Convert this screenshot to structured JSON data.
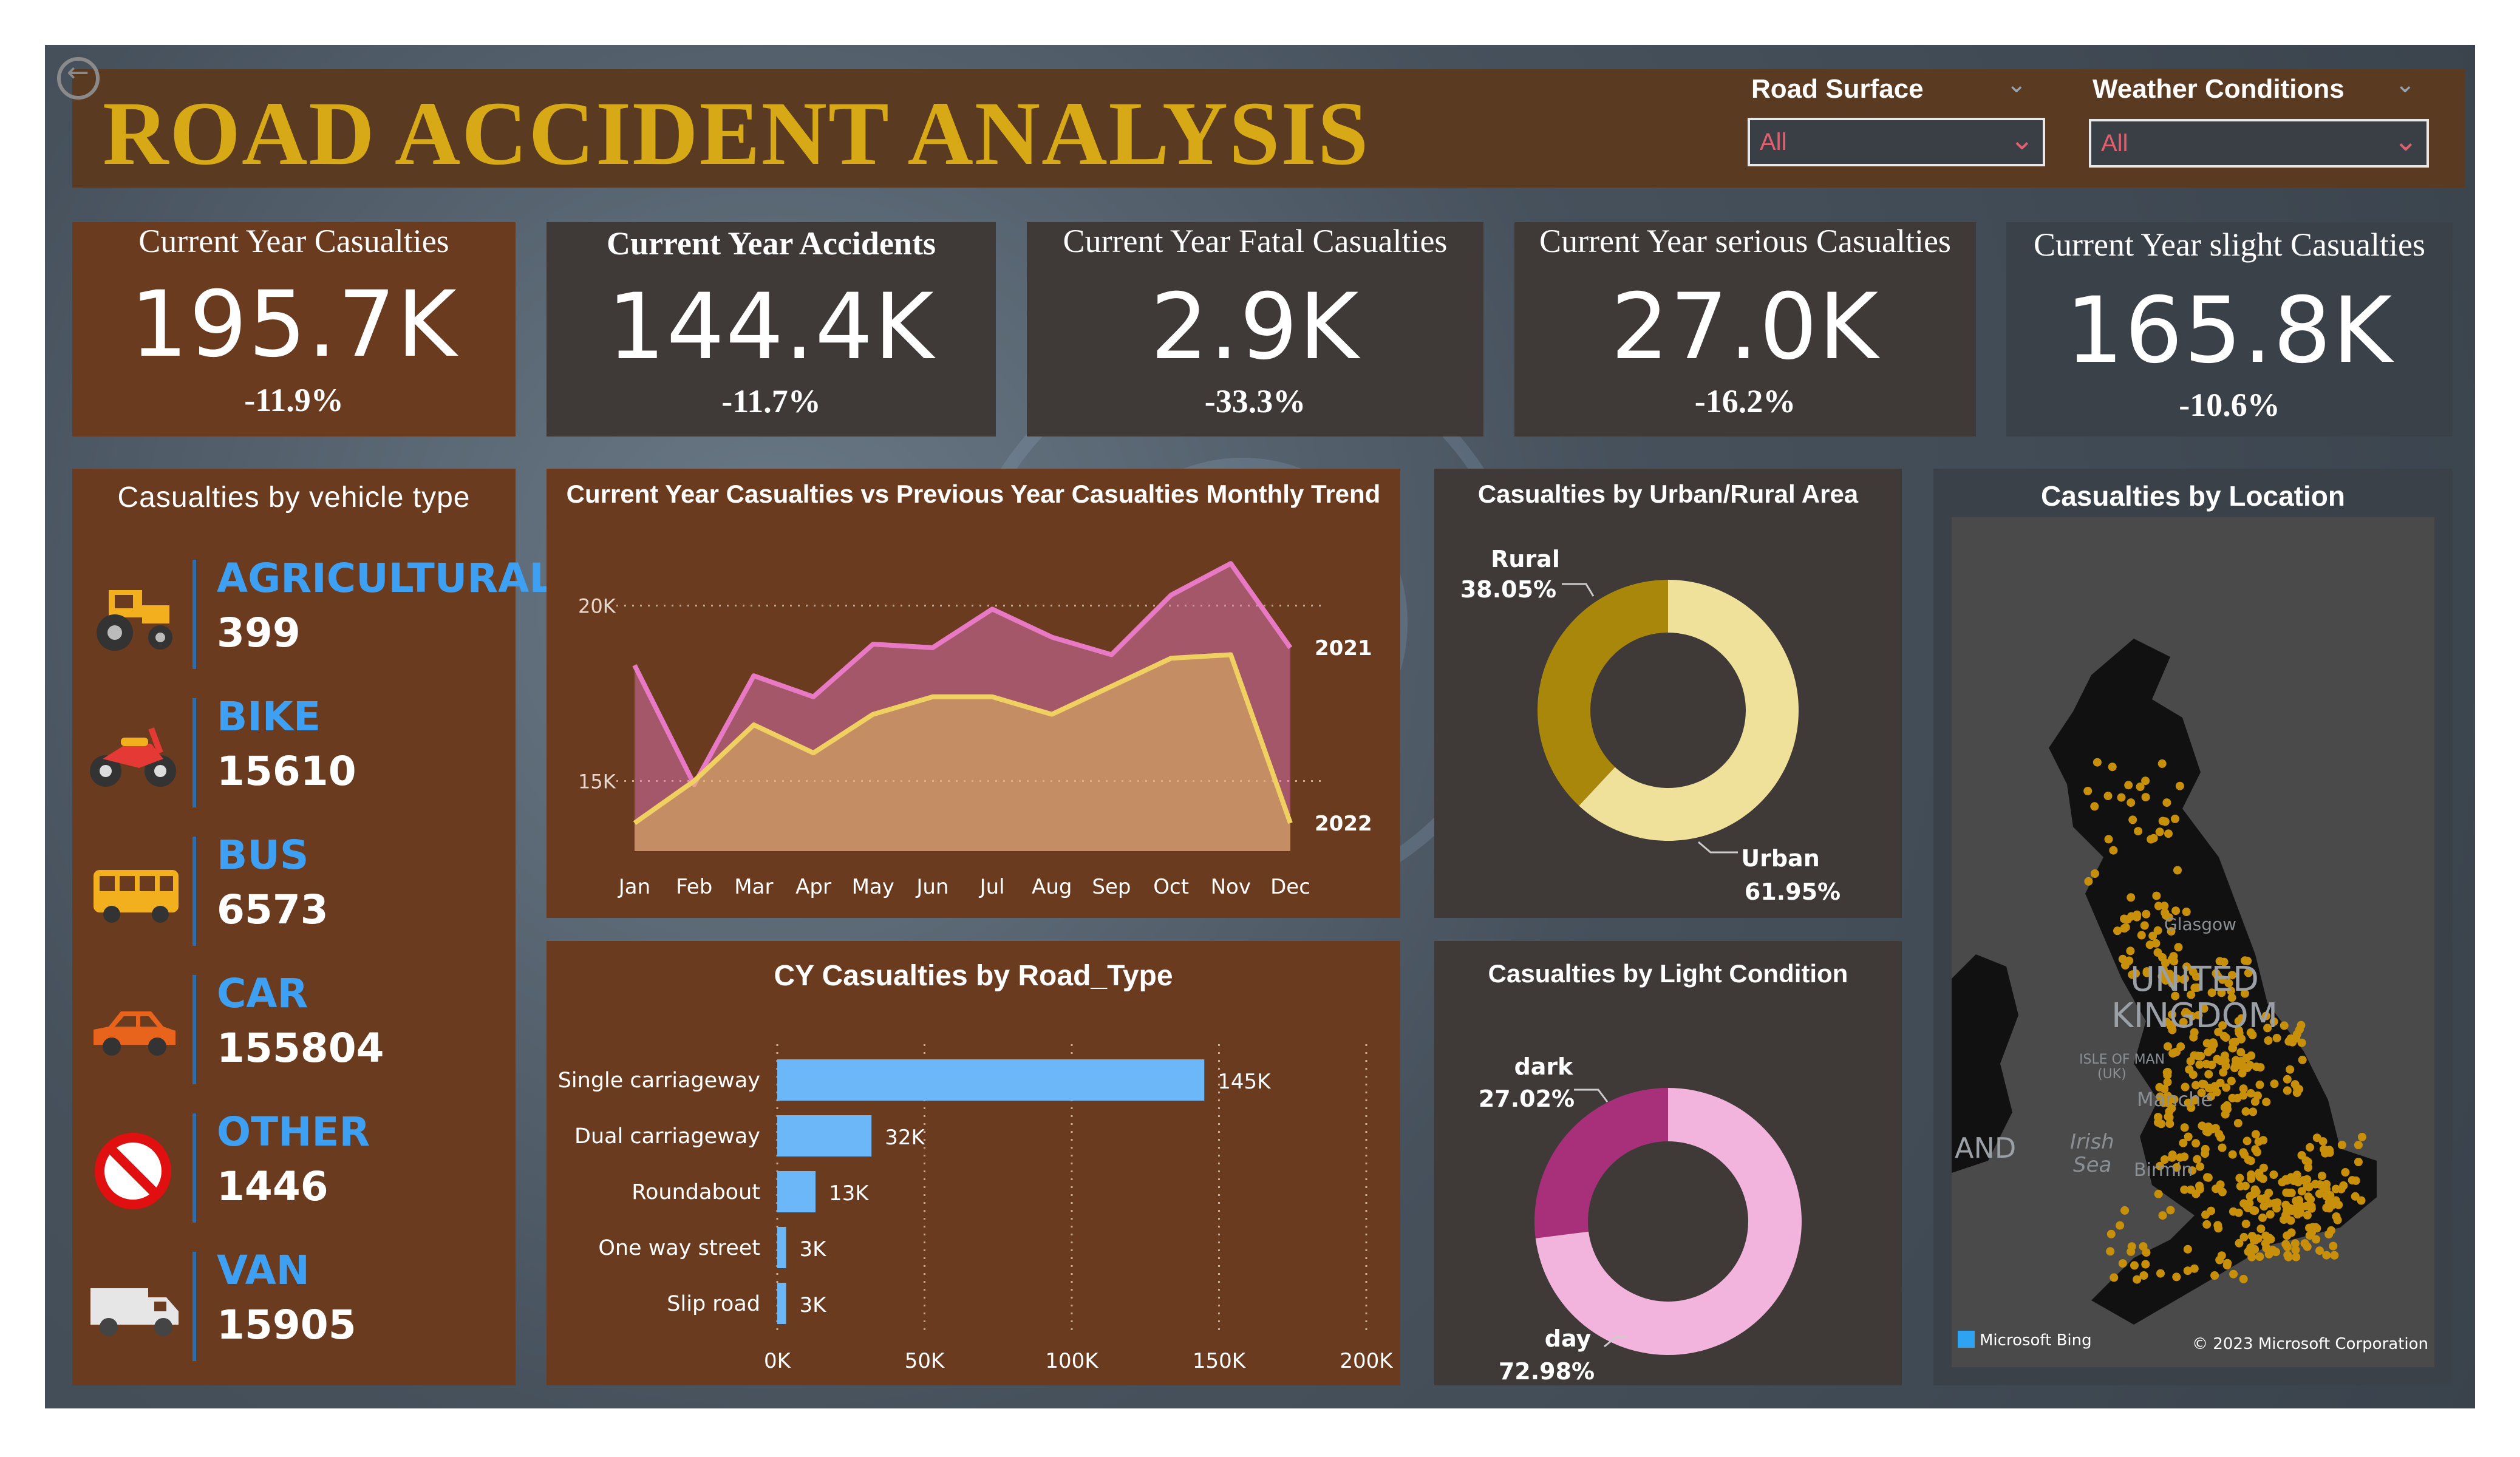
{
  "header": {
    "title": "ROAD ACCIDENT ANALYSIS",
    "slicers": [
      {
        "label": "Road Surface",
        "value": "All"
      },
      {
        "label": "Weather Conditions",
        "value": "All"
      }
    ]
  },
  "kpis": [
    {
      "title": "Current Year Casualties",
      "value": "195.7K",
      "delta": "-11.9%"
    },
    {
      "title": "Current Year Accidents",
      "value": "144.4K",
      "delta": "-11.7%"
    },
    {
      "title": "Current Year Fatal Casualties",
      "value": "2.9K",
      "delta": "-33.3%"
    },
    {
      "title": "Current Year serious Casualties",
      "value": "27.0K",
      "delta": "-16.2%"
    },
    {
      "title": "Current Year slight Casualties",
      "value": "165.8K",
      "delta": "-10.6%"
    }
  ],
  "vehicles": {
    "title": "Casualties by vehicle type",
    "items": [
      {
        "name": "AGRICULTURAL",
        "value": "399",
        "icon": "tractor-icon"
      },
      {
        "name": "BIKE",
        "value": "15610",
        "icon": "motorbike-icon"
      },
      {
        "name": "BUS",
        "value": "6573",
        "icon": "bus-icon"
      },
      {
        "name": "CAR",
        "value": "155804",
        "icon": "car-icon"
      },
      {
        "name": "OTHER",
        "value": "1446",
        "icon": "prohibited-icon"
      },
      {
        "name": "VAN",
        "value": "15905",
        "icon": "van-icon"
      }
    ]
  },
  "trend": {
    "title": "Current Year Casualties vs Previous Year Casualties Monthly Trend",
    "y_ticks": [
      "20K",
      "15K"
    ],
    "series_labels": [
      "2021",
      "2022"
    ]
  },
  "urban_rural": {
    "title": "Casualties by Urban/Rural Area",
    "labels": [
      {
        "name": "Rural",
        "pct": "38.05%"
      },
      {
        "name": "Urban",
        "pct": "61.95%"
      }
    ]
  },
  "road_type": {
    "title": "CY Casualties by Road_Type",
    "x_ticks": [
      "0K",
      "50K",
      "100K",
      "150K",
      "200K"
    ]
  },
  "light": {
    "title": "Casualties by Light Condition",
    "labels": [
      {
        "name": "dark",
        "pct": "27.02%"
      },
      {
        "name": "day",
        "pct": "72.98%"
      }
    ]
  },
  "location": {
    "title": "Casualties by Location",
    "map_labels": [
      "UNITED",
      "KINGDOM",
      "Glasgow",
      "ISLE OF MAN",
      "(UK)",
      "Manche",
      "Irish",
      "Sea",
      "Birmin",
      "AND"
    ],
    "brand": "Microsoft Bing",
    "copyright": "© 2023 Microsoft Corporation"
  },
  "colors": {
    "panel": "#6a3b1e",
    "gold": "#d8a916",
    "blue": "#3ea0f2",
    "bar": "#6bb7f7",
    "line_2021": "#e879c4",
    "line_2022": "#f0d060",
    "rural": "#a8870a",
    "urban": "#f0e19a",
    "dark": "#a8307a",
    "day": "#f2b4dc"
  },
  "chart_data": [
    {
      "type": "area",
      "title": "Current Year Casualties vs Previous Year Casualties Monthly Trend",
      "categories": [
        "Jan",
        "Feb",
        "Mar",
        "Apr",
        "May",
        "Jun",
        "Jul",
        "Aug",
        "Sep",
        "Oct",
        "Nov",
        "Dec"
      ],
      "series": [
        {
          "name": "2021",
          "values": [
            18300,
            14900,
            18000,
            17400,
            18900,
            18800,
            19900,
            19100,
            18600,
            20300,
            21200,
            18800
          ]
        },
        {
          "name": "2022",
          "values": [
            13800,
            15000,
            16600,
            15800,
            16900,
            17400,
            17400,
            16900,
            17700,
            18500,
            18600,
            13800
          ]
        }
      ],
      "y_ticks": [
        15000,
        20000
      ],
      "ylim": [
        13000,
        22000
      ],
      "grid": "horizontal dotted"
    },
    {
      "type": "pie",
      "title": "Casualties by Urban/Rural Area",
      "labels": [
        "Rural",
        "Urban"
      ],
      "values": [
        38.05,
        61.95
      ]
    },
    {
      "type": "bar",
      "orientation": "horizontal",
      "title": "CY Casualties by Road_Type",
      "categories": [
        "Single carriageway",
        "Dual carriageway",
        "Roundabout",
        "One way street",
        "Slip road"
      ],
      "values": [
        145000,
        32000,
        13000,
        3000,
        3000
      ],
      "data_labels": [
        "145K",
        "32K",
        "13K",
        "3K",
        "3K"
      ],
      "xlim": [
        0,
        200000
      ]
    },
    {
      "type": "pie",
      "title": "Casualties by Light Condition",
      "labels": [
        "dark",
        "day"
      ],
      "values": [
        27.02,
        72.98
      ]
    }
  ]
}
